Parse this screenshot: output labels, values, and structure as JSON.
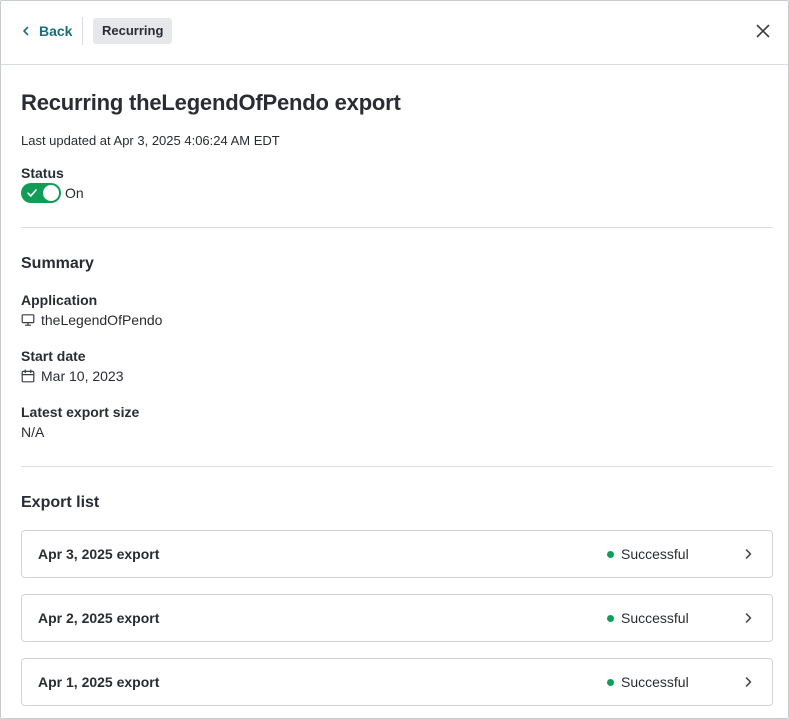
{
  "header": {
    "back_label": "Back",
    "breadcrumb": "Recurring"
  },
  "page": {
    "title": "Recurring theLegendOfPendo export",
    "last_updated": "Last updated at Apr 3, 2025 4:06:24 AM EDT"
  },
  "status": {
    "label": "Status",
    "value": "On",
    "enabled": true
  },
  "summary": {
    "title": "Summary",
    "application_label": "Application",
    "application_value": "theLegendOfPendo",
    "start_date_label": "Start date",
    "start_date_value": "Mar 10, 2023",
    "export_size_label": "Latest export size",
    "export_size_value": "N/A"
  },
  "export_list": {
    "title": "Export list",
    "items": [
      {
        "name": "Apr 3, 2025 export",
        "status": "Successful"
      },
      {
        "name": "Apr 2, 2025 export",
        "status": "Successful"
      },
      {
        "name": "Apr 1, 2025 export",
        "status": "Successful"
      }
    ]
  },
  "colors": {
    "accent": "#1a6e7f",
    "success": "#0f9d58",
    "text": "#2a2c35"
  }
}
